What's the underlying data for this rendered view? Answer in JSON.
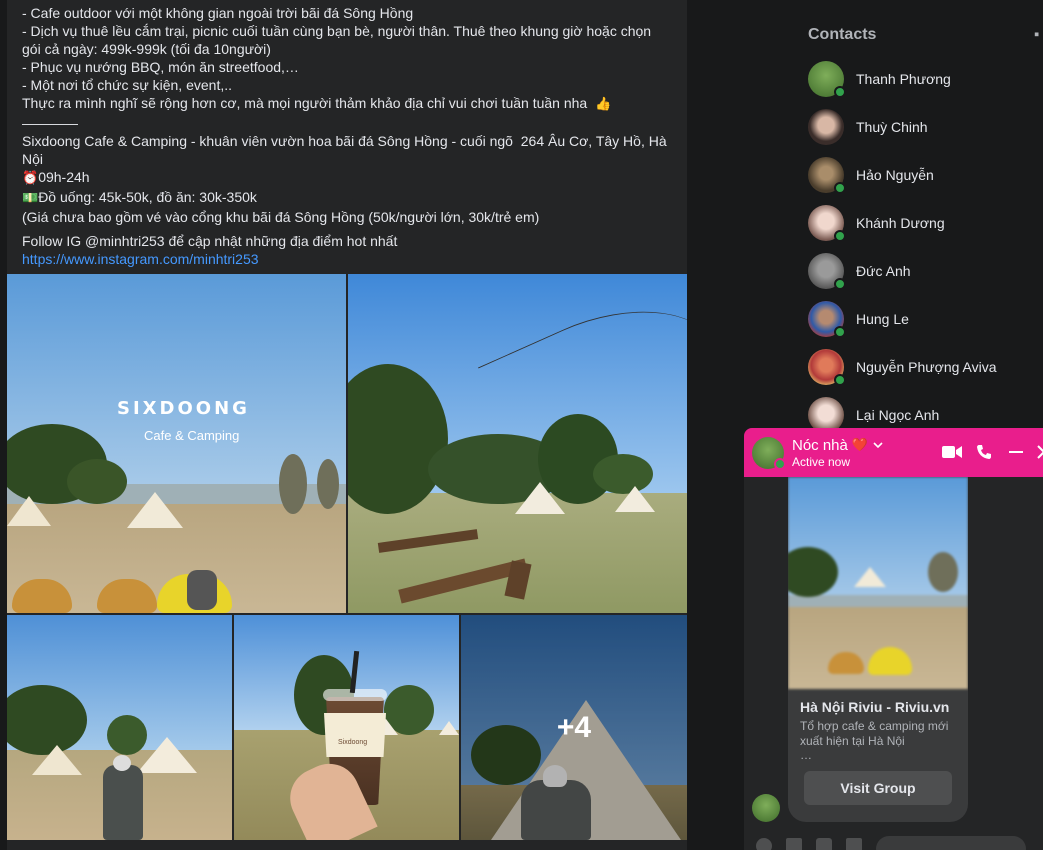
{
  "post": {
    "lines": [
      "- Cafe outdoor với một không gian ngoài trời bãi đá Sông Hồng",
      "- Dịch vụ thuê lều cắm trại, picnic cuối tuần cùng bạn bè, người thân. Thuê theo khung giờ hoặc chọn gói cả ngày: 499k-999k (tối đa 10người)",
      "- Phục vụ nướng BBQ, món ăn streetfood,…",
      "- Một nơi tổ chức sự kiện, event,..",
      "Thực ra mình nghĩ sẽ rộng hơn cơ, mà mọi người thảm khảo địa chỉ vui chơi tuần tuần nha"
    ],
    "thumbs_emoji": "👍",
    "divider": "————",
    "venue": "Sixdoong Cafe & Camping - khuân viên vườn hoa bãi đá Sông Hồng - cuối ngõ  264 Âu Cơ, Tây Hồ, Hà Nội",
    "hours_emoji": "⏰",
    "hours": "09h-24h",
    "price_emoji": "💵",
    "price": "Đồ uống: 45k-50k, đồ ăn: 30k-350k",
    "note": "(Giá chưa bao gồm vé vào cổng khu bãi đá Sông Hồng (50k/người lớn, 30k/trẻ em)",
    "follow": "Follow IG @minhtri253 để cập nhật những địa điểm hot nhất",
    "link": "https://www.instagram.com/minhtri253",
    "photo_brand": "SIXDOONG",
    "photo_brand_sub": "Cafe & Camping",
    "cup_label": "Sixdoong",
    "more_photos": "+4"
  },
  "contacts": {
    "title": "Contacts",
    "items": [
      {
        "name": "Thanh Phương"
      },
      {
        "name": "Thuỳ Chinh"
      },
      {
        "name": "Hảo Nguyễn"
      },
      {
        "name": "Khánh Dương"
      },
      {
        "name": "Đức Anh"
      },
      {
        "name": "Hung Le"
      },
      {
        "name": "Nguyễn Phượng Aviva"
      },
      {
        "name": "Lại Ngọc Anh"
      }
    ]
  },
  "chat": {
    "title": "Nóc nhà",
    "heart": "❤️",
    "status": "Active now",
    "card": {
      "title": "Hà Nội Riviu - Riviu.vn",
      "description": "Tổ hợp cafe & camping mới xuất hiện tại Hà Nội",
      "ellipsis": "…",
      "button": "Visit Group"
    }
  },
  "colors": {
    "page_bg": "#18191a",
    "card_bg": "#242526",
    "link": "#4599ff",
    "chat_header": "#e91e8c",
    "online": "#31a24c"
  }
}
